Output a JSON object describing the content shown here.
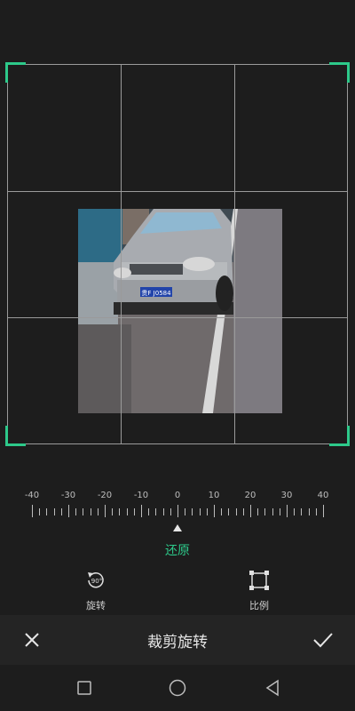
{
  "ruler": {
    "labels": [
      "-40",
      "-30",
      "-20",
      "-10",
      "0",
      "10",
      "20",
      "30",
      "40"
    ],
    "value": 0
  },
  "reset_label": "还原",
  "tools": {
    "rotate_label": "旋转",
    "rotate_badge": "90°",
    "ratio_label": "比例"
  },
  "bottom_bar": {
    "title": "裁剪旋转"
  },
  "colors": {
    "accent": "#2dc98a",
    "background": "#1d1d1d",
    "grid": "#9a9a9a"
  },
  "photo": {
    "plate_text": "贵F J0584"
  }
}
